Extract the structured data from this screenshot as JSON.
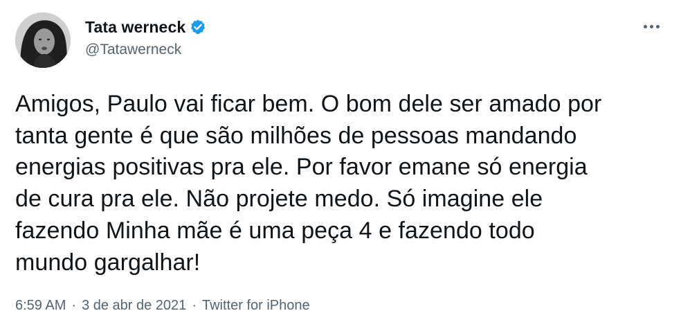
{
  "user": {
    "display_name": "Tata werneck",
    "handle": "@Tatawerneck",
    "verified": true
  },
  "more_icon": "more-horizontal-icon",
  "tweet": {
    "text": "Amigos, Paulo vai ficar bem. O bom dele ser amado por\ntanta gente é que são milhões de pessoas mandando\nenergias positivas pra ele. Por favor emane só energia\nde cura pra ele. Não projete medo. Só imagine ele\nfazendo Minha mãe é uma peça 4 e fazendo todo\nmundo gargalhar!"
  },
  "meta": {
    "time": "6:59 AM",
    "separator": "·",
    "date": "3 de abr de 2021",
    "source": "Twitter for iPhone"
  },
  "colors": {
    "verified_badge": "#1d9bf0",
    "text_primary": "#0f1419",
    "text_secondary": "#536471"
  }
}
